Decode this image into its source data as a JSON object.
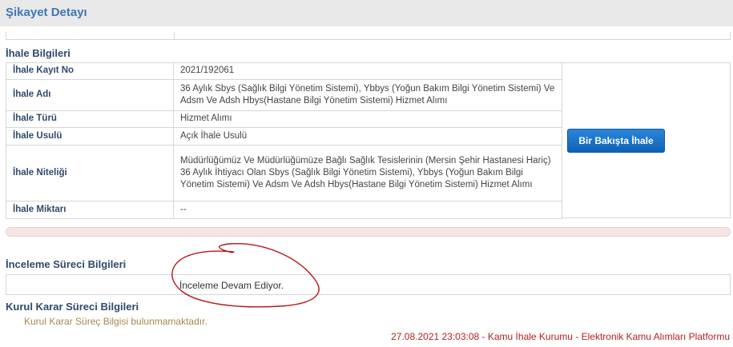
{
  "header": {
    "title": "Şikayet Detayı"
  },
  "ihale": {
    "section_title": "İhale Bilgileri",
    "rows": [
      {
        "label": "İhale Kayıt No",
        "value": "2021/192061"
      },
      {
        "label": "İhale Adı",
        "value": "36 Aylık Sbys (Sağlık Bilgi Yönetim Sistemi), Ybbys (Yoğun Bakım Bilgi Yönetim Sistemi) Ve Adsm Ve Adsh Hbys(Hastane Bilgi Yönetim Sistemi) Hizmet Alımı"
      },
      {
        "label": "İhale Türü",
        "value": "Hizmet Alımı"
      },
      {
        "label": "İhale Usulü",
        "value": "Açık İhale Usulü"
      },
      {
        "label": "İhale Niteliği",
        "value": "Müdürlüğümüz Ve Müdürlüğümüze Bağlı Sağlık Tesislerinin (Mersin Şehir Hastanesi Hariç) 36 Aylık İhtiyacı Olan Sbys (Sağlık Bilgi Yönetim Sistemi), Ybbys (Yoğun Bakım Bilgi Yönetim Sistemi) Ve Adsm Ve Adsh Hbys(Hastane Bilgi Yönetim Sistemi) Hizmet Alımı"
      },
      {
        "label": "İhale Miktarı",
        "value": "--"
      }
    ],
    "button_label": "Bir Bakışta İhale"
  },
  "inceleme": {
    "section_title": "İnceleme Süreci Bilgileri",
    "status": "İnceleme Devam Ediyor."
  },
  "kurul": {
    "section_title": "Kurul Karar Süreci Bilgileri",
    "note": "Kurul Karar Süreç Bilgisi bulunmamaktadır."
  },
  "footer": {
    "text": "27.08.2021 23:03:08 - Kamu İhale Kurumu - Elektronik Kamu Alımları Platformu"
  },
  "colors": {
    "title_blue": "#3d78b5",
    "button_blue": "#1a73c8",
    "footer_red": "#b51f1f",
    "annotation_red": "#b5161b"
  }
}
